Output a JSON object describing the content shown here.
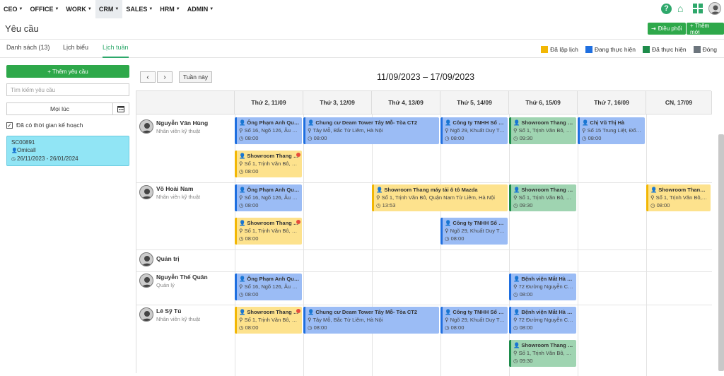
{
  "nav": {
    "items": [
      {
        "label": "CEO"
      },
      {
        "label": "OFFICE"
      },
      {
        "label": "WORK"
      },
      {
        "label": "CRM"
      },
      {
        "label": "SALES"
      },
      {
        "label": "HRM"
      },
      {
        "label": "ADMIN"
      }
    ],
    "active": "CRM"
  },
  "header": {
    "title": "Yêu cầu",
    "dispatch_label": "Điều phối",
    "new_label": "+ Thêm mới"
  },
  "tabs": [
    {
      "label": "Danh sách (13)"
    },
    {
      "label": "Lịch biểu"
    },
    {
      "label": "Lịch tuần"
    }
  ],
  "legend": [
    {
      "label": "Đã lập lịch",
      "color": "#f2b705"
    },
    {
      "label": "Đang thực hiện",
      "color": "#1f6fe0"
    },
    {
      "label": "Đã thực hiện",
      "color": "#1e8c4b"
    },
    {
      "label": "Đóng",
      "color": "#6c757d"
    }
  ],
  "sidebar": {
    "add_label": "+ Thêm yêu cầu",
    "search_placeholder": "Tìm kiếm yêu cầu",
    "date_label": "Mọi lúc",
    "checkbox_label": "Đã có thời gian kế hoạch",
    "card": {
      "code": "SC00891",
      "contact": "Omicall",
      "dates": "26/11/2023 - 26/01/2024"
    }
  },
  "calendar": {
    "today_label": "Tuần này",
    "range": "11/09/2023 – 17/09/2023",
    "days": [
      "Thứ 2, 11/09",
      "Thứ 3, 12/09",
      "Thứ 4, 13/09",
      "Thứ 5, 14/09",
      "Thứ 6, 15/09",
      "Thứ 7, 16/09",
      "CN, 17/09"
    ],
    "people": [
      {
        "name": "Nguyễn Văn Hùng",
        "role": "Nhân viên kỹ thuật"
      },
      {
        "name": "Võ Hoài Nam",
        "role": "Nhân viên kỹ thuật"
      },
      {
        "name": "Quản trị",
        "role": ""
      },
      {
        "name": "Nguyễn Thế Quân",
        "role": "Quản lý"
      },
      {
        "name": "Lê Sỹ Tú",
        "role": "Nhân viên kỹ thuật"
      }
    ],
    "events": [
      {
        "title": "Ông Phạm Anh Quân",
        "addr": "Số 16, Ngõ 126, Âu Cơ...",
        "time": "08:00",
        "status": "b"
      },
      {
        "title": "Chung cư Deam Tower Tây Mỗ- Tòa CT2",
        "addr": "Tây Mỗ, Bắc Từ Liêm, Hà Nội",
        "time": "08:00",
        "status": "b"
      },
      {
        "title": "Công ty TNHH Số 6 ...",
        "addr": "Ngõ 29, Khuất Duy Tiế...",
        "time": "08:00",
        "status": "b"
      },
      {
        "title": "Showroom Thang m...",
        "addr": "Số 1, Trịnh Văn Bô, Qu...",
        "time": "09:30",
        "status": "g"
      },
      {
        "title": "Chị Vũ Thị Hà",
        "addr": "Số 15 Trung Liệt, Đốn...",
        "time": "08:00",
        "status": "b"
      },
      {
        "title": "Showroom Thang m...",
        "addr": "Số 1, Trịnh Văn Bô, Qu...",
        "time": "08:00",
        "status": "y"
      },
      {
        "title": "Ông Phạm Anh Quân",
        "addr": "Số 16, Ngõ 126, Âu Cơ...",
        "time": "08:00",
        "status": "b"
      },
      {
        "title": "Showroom Thang máy tải ô tô Mazda",
        "addr": "Số 1, Trịnh Văn Bô, Quận Nam Từ Liêm, Hà Nội",
        "time": "13:53",
        "status": "y"
      },
      {
        "title": "Showroom Thang m...",
        "addr": "Số 1, Trịnh Văn Bô, Qu...",
        "time": "09:30",
        "status": "g"
      },
      {
        "title": "Showroom Thang m...",
        "addr": "Số 1, Trịnh Văn Bô, Qu...",
        "time": "08:00",
        "status": "y"
      },
      {
        "title": "Showroom Thang m...",
        "addr": "Số 1, Trịnh Văn Bô, Qu...",
        "time": "08:00",
        "status": "y"
      },
      {
        "title": "Công ty TNHH Số 6 ...",
        "addr": "Ngõ 29, Khuất Duy Tiế...",
        "time": "08:00",
        "status": "b"
      },
      {
        "title": "Ông Phạm Anh Quân",
        "addr": "Số 16, Ngõ 126, Âu Cơ...",
        "time": "08:00",
        "status": "b"
      },
      {
        "title": "Bệnh viện Mắt Hà N...",
        "addr": "72 Đường Nguyễn Chí ...",
        "time": "08:00",
        "status": "b"
      },
      {
        "title": "Showroom Thang m...",
        "addr": "Số 1, Trịnh Văn Bô, Qu...",
        "time": "08:00",
        "status": "y"
      },
      {
        "title": "Chung cư Deam Tower Tây Mỗ- Tòa CT2",
        "addr": "Tây Mỗ, Bắc Từ Liêm, Hà Nội",
        "time": "08:00",
        "status": "b"
      },
      {
        "title": "Công ty TNHH Số 6 ...",
        "addr": "Ngõ 29, Khuất Duy Tiế...",
        "time": "08:00",
        "status": "b"
      },
      {
        "title": "Bệnh viện Mắt Hà N...",
        "addr": "72 Đường Nguyễn Chí ...",
        "time": "08:00",
        "status": "b"
      },
      {
        "title": "Showroom Thang m...",
        "addr": "Số 1, Trịnh Văn Bô, Qu...",
        "time": "09:30",
        "status": "g"
      }
    ]
  }
}
